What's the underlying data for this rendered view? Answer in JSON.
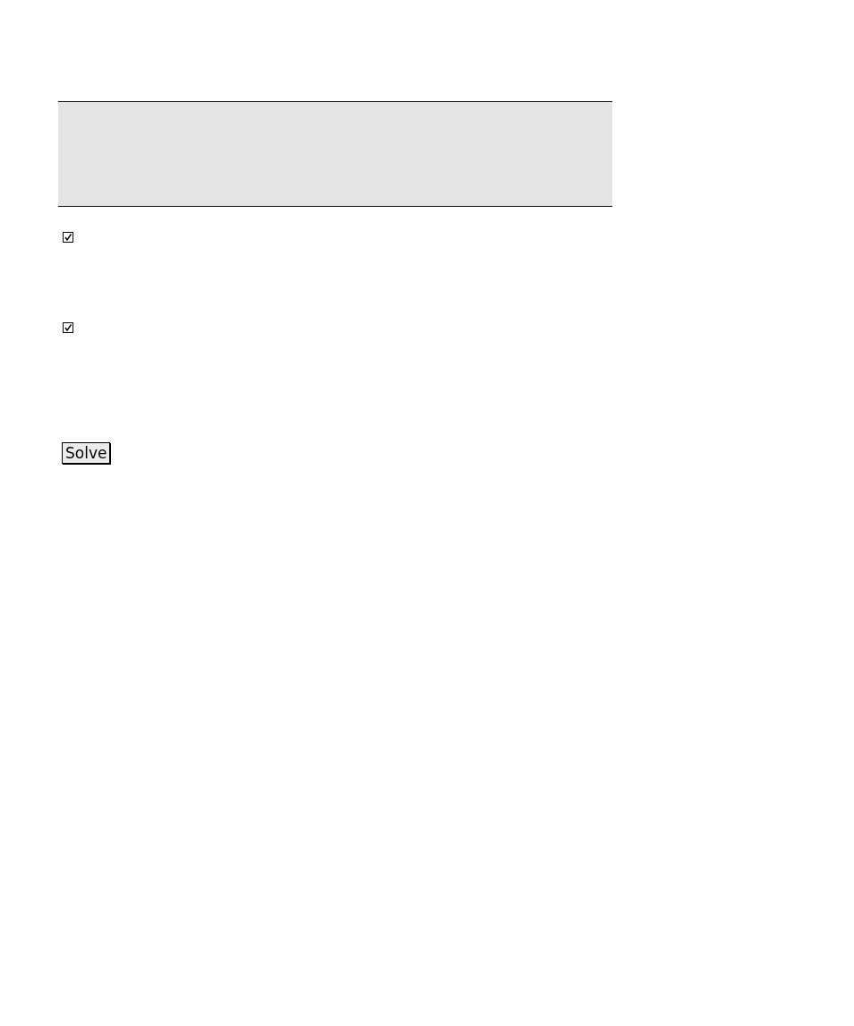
{
  "checkboxes": [
    {
      "checked": true
    },
    {
      "checked": true
    }
  ],
  "solve_button": {
    "label": "Solve"
  }
}
